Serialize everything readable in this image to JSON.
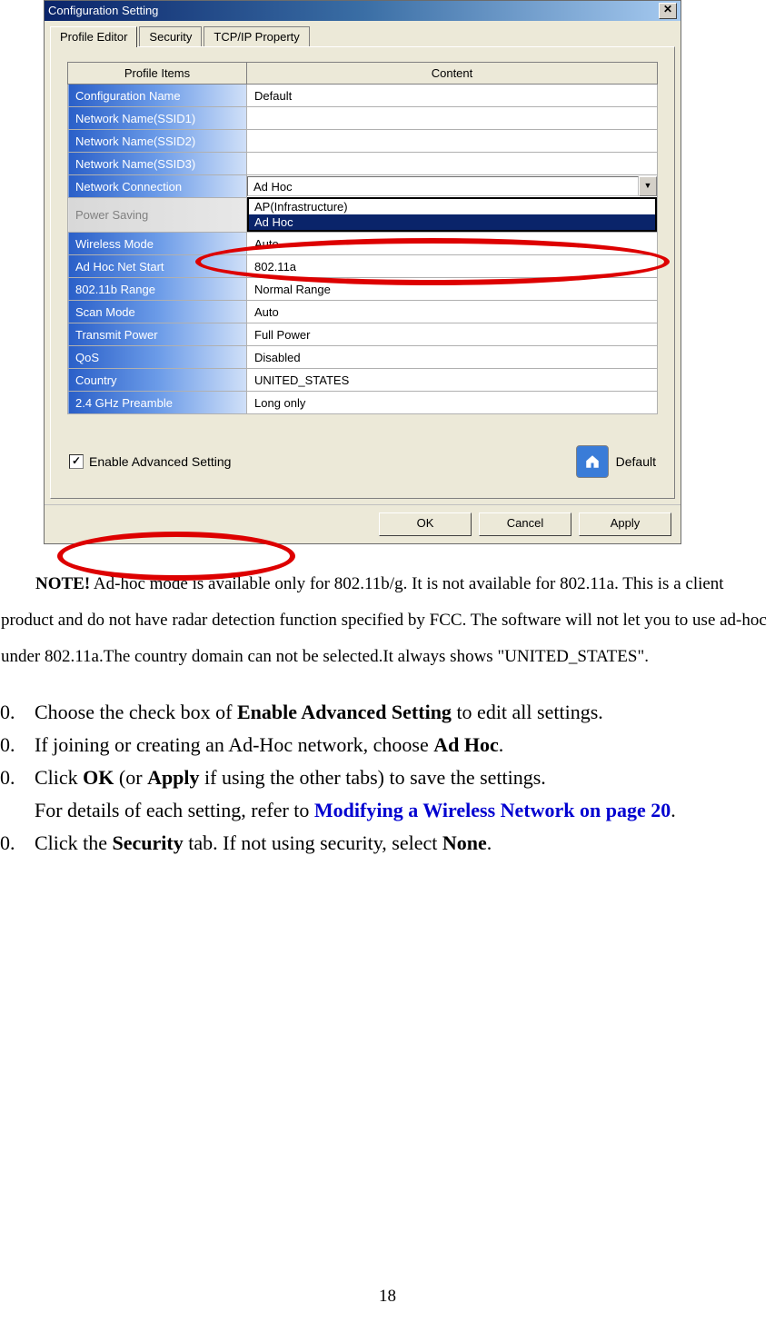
{
  "dialog": {
    "title": "Configuration Setting",
    "tabs": [
      "Profile Editor",
      "Security",
      "TCP/IP Property"
    ],
    "active_tab": 0,
    "table": {
      "headers": [
        "Profile Items",
        "Content"
      ],
      "rows": [
        {
          "item": "Configuration Name",
          "content": "Default"
        },
        {
          "item": "Network Name(SSID1)",
          "content": ""
        },
        {
          "item": "Network Name(SSID2)",
          "content": ""
        },
        {
          "item": "Network Name(SSID3)",
          "content": ""
        },
        {
          "item": "Network Connection",
          "content": "Ad Hoc",
          "combo": true
        },
        {
          "item": "Power Saving",
          "disabled": true,
          "dropdown": {
            "options": [
              "AP(Infrastructure)",
              "Ad Hoc"
            ],
            "selected": 1
          }
        },
        {
          "item": "Wireless Mode",
          "content": "Auto"
        },
        {
          "item": "Ad Hoc Net Start",
          "content": "802.11a"
        },
        {
          "item": "802.11b Range",
          "content": "Normal Range"
        },
        {
          "item": "Scan Mode",
          "content": "Auto"
        },
        {
          "item": "Transmit Power",
          "content": "Full Power"
        },
        {
          "item": "QoS",
          "content": "Disabled"
        },
        {
          "item": "Country",
          "content": "UNITED_STATES"
        },
        {
          "item": "2.4 GHz Preamble",
          "content": "Long only"
        }
      ]
    },
    "advanced_checkbox": {
      "label": "Enable Advanced Setting",
      "checked": true
    },
    "default_button": "Default",
    "buttons": [
      "OK",
      "Cancel",
      "Apply"
    ]
  },
  "document": {
    "note_label": "NOTE!",
    "note_text": " Ad-hoc mode is available only for 802.11b/g.    It is not available for 802.11a.    This is a client product and do not have radar detection function specified by FCC.    The software will not let you to use ad-hoc under 802.11a.The country domain can not be selected.It always shows \"UNITED_STATES\".",
    "steps": [
      {
        "n": "0.",
        "pre": "Choose the check box of ",
        "b1": "Enable Advanced Setting",
        "post": " to edit all settings."
      },
      {
        "n": "0.",
        "pre": "If joining or creating an Ad-Hoc network, choose ",
        "b1": "Ad Hoc",
        "post": "."
      },
      {
        "n": "0.",
        "pre": "Click ",
        "b1": "OK",
        "mid": " (or ",
        "b2": "Apply",
        "post": " if using the other tabs) to save the settings."
      },
      {
        "n": "",
        "pre": "For details of each setting, refer to ",
        "link": "Modifying a Wireless Network on page 20",
        "post": "."
      },
      {
        "n": "0.",
        "pre": "Click the ",
        "b1": "Security",
        "mid": " tab. If not using security, select ",
        "b2": "None",
        "post": "."
      }
    ],
    "page_number": "18"
  }
}
